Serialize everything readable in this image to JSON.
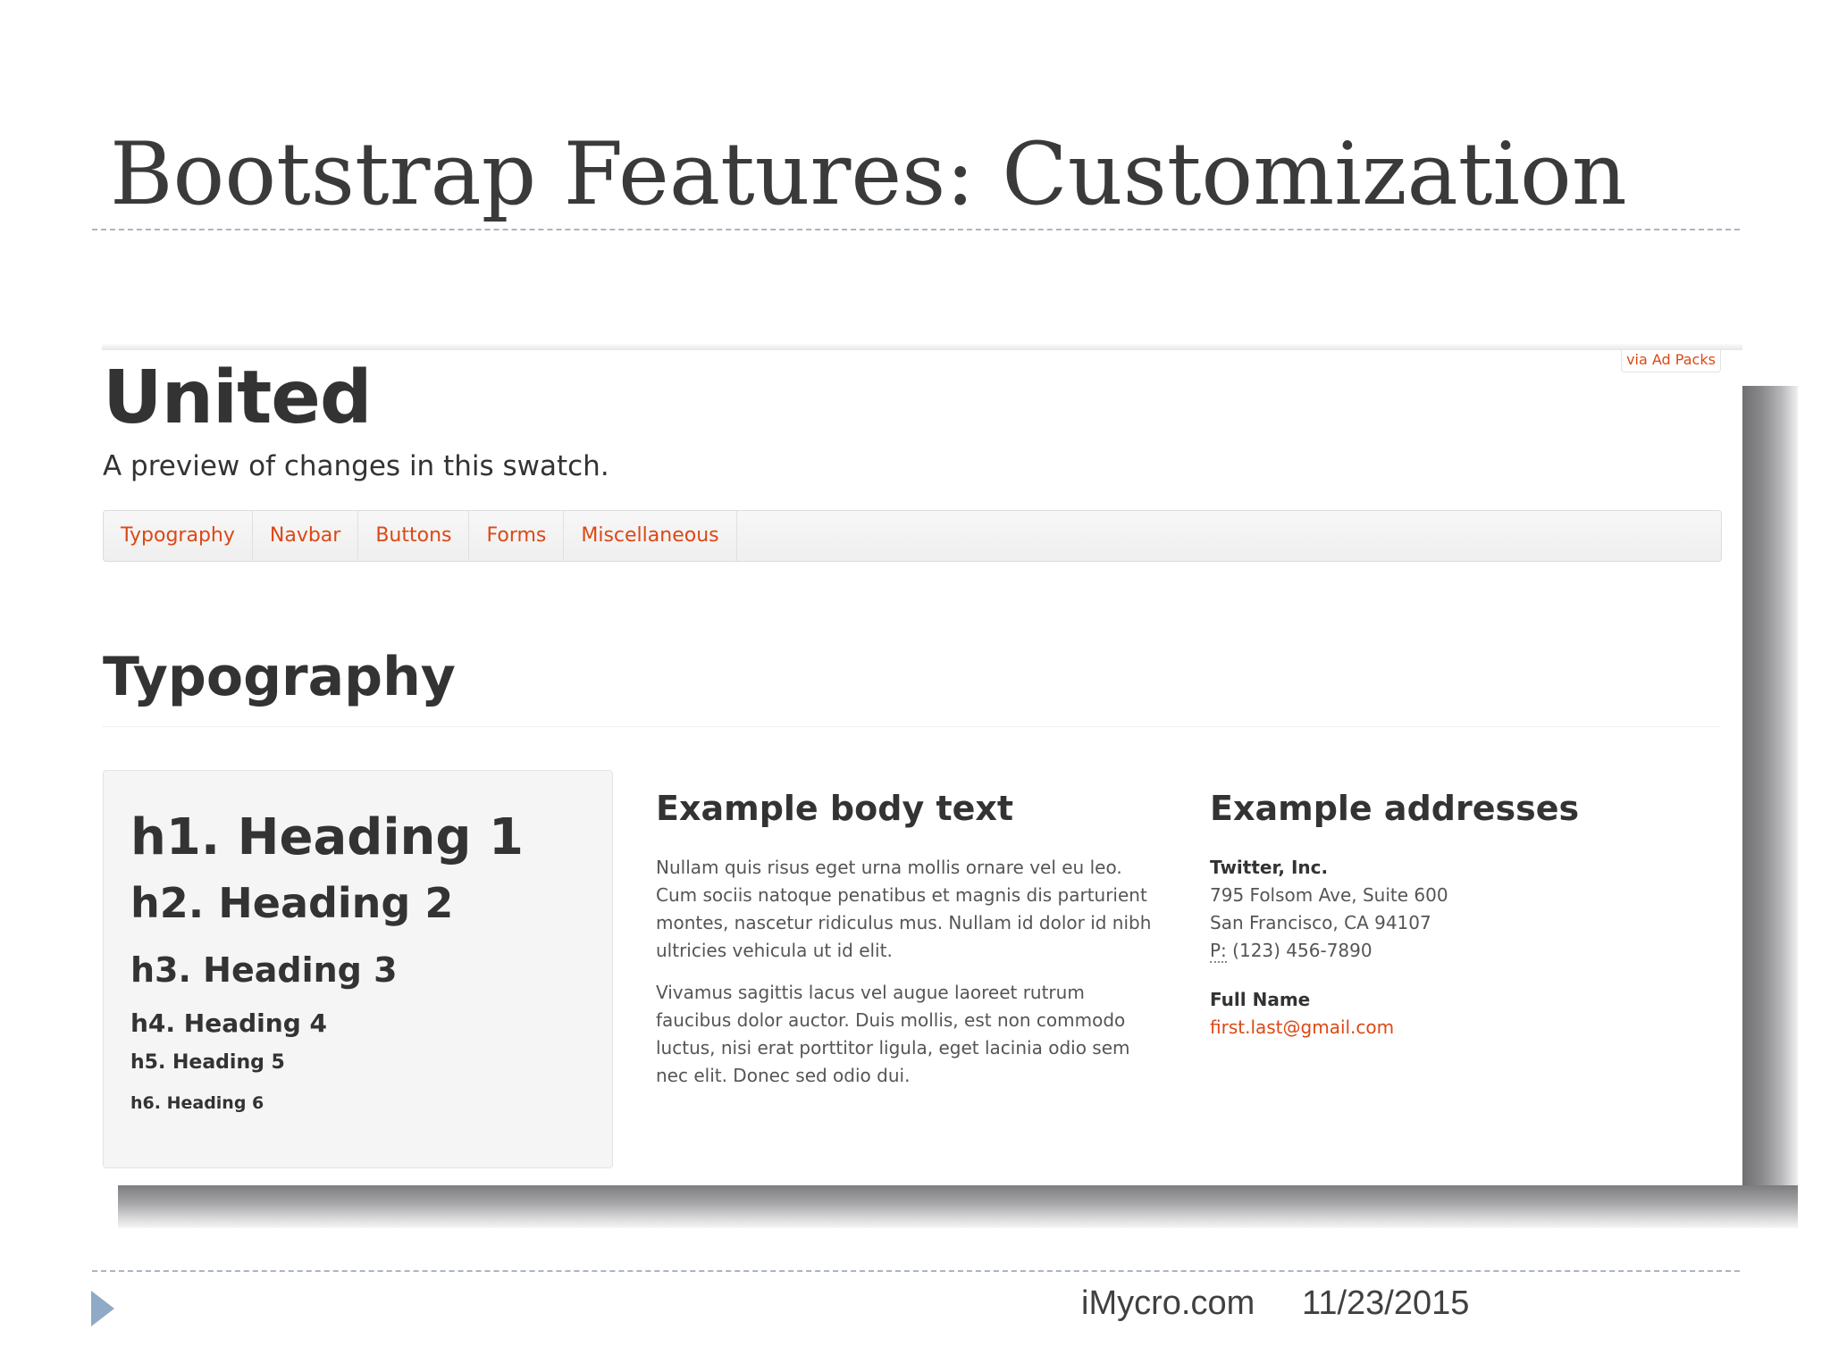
{
  "slide": {
    "title": "Bootstrap Features: Customization",
    "footer": {
      "site": "iMycro.com",
      "date": "11/23/2015"
    }
  },
  "preview": {
    "ad_label": "via Ad Packs",
    "brand": "United",
    "tagline": "A preview of changes in this swatch.",
    "nav": [
      "Typography",
      "Navbar",
      "Buttons",
      "Forms",
      "Miscellaneous"
    ],
    "section_title": "Typography",
    "headings": [
      "h1. Heading 1",
      "h2. Heading 2",
      "h3. Heading 3",
      "h4. Heading 4",
      "h5. Heading 5",
      "h6. Heading 6"
    ],
    "body_text": {
      "title": "Example body text",
      "paragraphs": [
        "Nullam quis risus eget urna mollis ornare vel eu leo. Cum sociis natoque penatibus et magnis dis parturient montes, nascetur ridiculus mus. Nullam id dolor id nibh ultricies vehicula ut id elit.",
        "Vivamus sagittis lacus vel augue laoreet rutrum faucibus dolor auctor. Duis mollis, est non commodo luctus, nisi erat porttitor ligula, eget lacinia odio sem nec elit. Donec sed odio dui."
      ]
    },
    "addresses": {
      "title": "Example addresses",
      "company": "Twitter, Inc.",
      "street": "795 Folsom Ave, Suite 600",
      "city": "San Francisco, CA 94107",
      "phone_label": "P:",
      "phone": "(123) 456-7890",
      "name": "Full Name",
      "email": "first.last@gmail.com"
    }
  },
  "colors": {
    "accent": "#dd4814",
    "text": "#333333",
    "muted": "#555555",
    "marker": "#8faac6"
  }
}
